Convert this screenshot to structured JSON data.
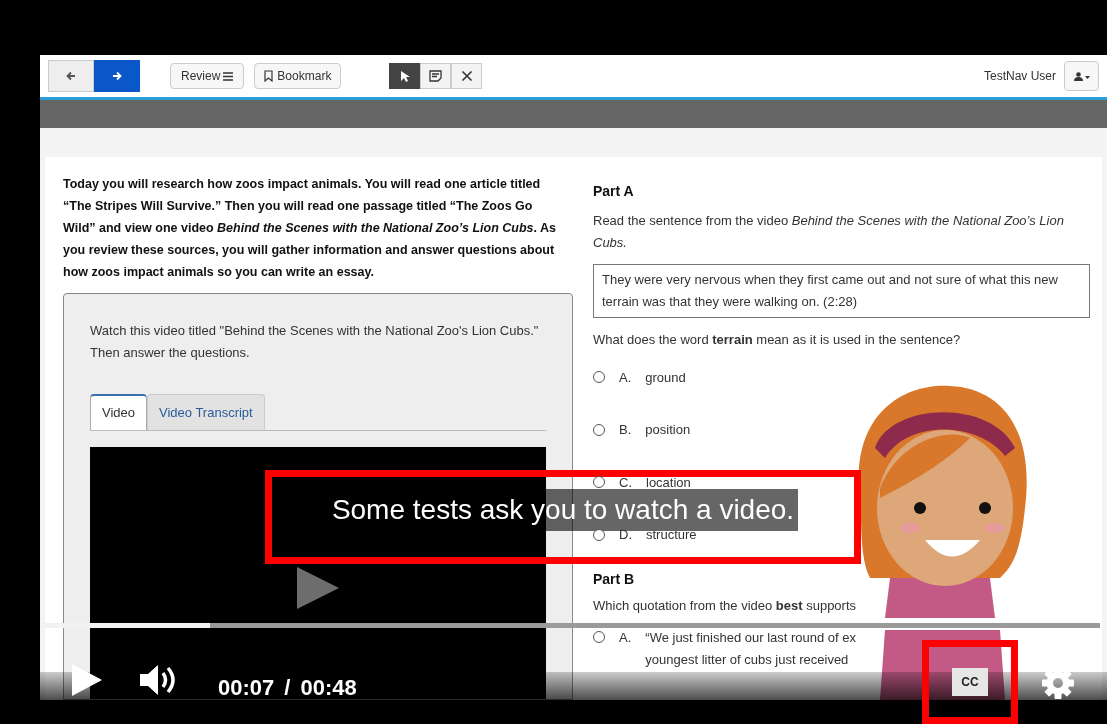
{
  "toolbar": {
    "nav": [
      {
        "kind": "back",
        "selected": false
      },
      {
        "kind": "forward",
        "selected": true
      }
    ],
    "review": "Review",
    "bookmark": "Bookmark",
    "tools": [
      {
        "kind": "pointer",
        "selected": true
      },
      {
        "kind": "note",
        "selected": false
      },
      {
        "kind": "eliminate",
        "selected": false
      }
    ],
    "user": "TestNav User"
  },
  "passage": {
    "intro": "Today you will research how zoos impact animals. You will read one article titled “The Stripes Will Survive.” Then you will read one passage titled “The Zoos Go Wild” and view one video *Behind the Scenes with the National Zoo’s Lion Cubs*. As you review these sources, you will gather information and answer questions about how zoos impact animals so you can write an essay.",
    "instruction": "Watch this video titled \"Behind the Scenes with the National Zoo's Lion Cubs.\" Then answer the questions.",
    "tabs": [
      {
        "label": "Video",
        "selected": true
      },
      {
        "label": "Video Transcript",
        "selected": false
      }
    ]
  },
  "part_a": {
    "heading": "Part A",
    "prompt": "Read the sentence from the video *Behind the Scenes with the National Zoo’s Lion Cubs.*",
    "quote": "They were very nervous when they first came out and not sure of what this new terrain was that they were walking on. (2:28)",
    "question": "What does the word **terrain** mean as it is used in the sentence?",
    "options": [
      {
        "letter": "A.",
        "text": "ground",
        "selected": false
      },
      {
        "letter": "B.",
        "text": "position",
        "selected": false
      },
      {
        "letter": "C.",
        "text": "location",
        "selected": false
      },
      {
        "letter": "D.",
        "text": "structure",
        "selected": false
      }
    ]
  },
  "part_b": {
    "heading": "Part B",
    "question": "Which quotation from the video **best** supports",
    "options": [
      {
        "letter": "A.",
        "lines": [
          "“We just finished our last round of ex",
          "youngest litter of cubs just received"
        ],
        "selected": false
      }
    ]
  },
  "player": {
    "caption": "Some tests ask you to watch a video.",
    "caption_highlighted": true,
    "progress": {
      "level": 0.16
    },
    "current_time": "00:07",
    "separator": "/",
    "duration": "00:48",
    "cc": {
      "label": "CC",
      "highlighted": true
    }
  }
}
